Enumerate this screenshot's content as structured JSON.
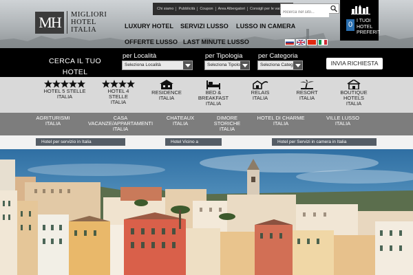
{
  "logo": {
    "mark": "MH",
    "line1": "MIGLIORI",
    "line2": "HOTEL",
    "line3": "ITALIA"
  },
  "toplinks": [
    "Chi siamo",
    "Pubblicità",
    "Coupon",
    "Area Albergatori",
    "Consigli per le vacanze"
  ],
  "search": {
    "placeholder": "Ricerca nel sito..."
  },
  "favorites": {
    "count": "0",
    "label_line1": "I TUOI",
    "label_line2": "HOTEL",
    "label_line3": "PREFERITI"
  },
  "mainnav": {
    "luxury": "LUXURY HOTEL",
    "servizi": "SERVIZI LUSSO",
    "camera": "LUSSO IN CAMERA",
    "offerte": "OFFERTE LUSSO",
    "lastminute": "LAST MINUTE LUSSO"
  },
  "flags": [
    "it-ru",
    "en",
    "de",
    "it"
  ],
  "searchbar": {
    "cerca_line1": "CERCA IL TUO",
    "cerca_line2": "HOTEL",
    "localita_label": "per Località",
    "localita_value": "Seleziona Località",
    "tipologia_label": "per Tipologia",
    "tipologia_value": "Seleziona Tipologia",
    "categoria_label": "per Categoria",
    "categoria_value": "Seleziona Categoria",
    "submit": "INVIA RICHIESTA"
  },
  "categories": [
    {
      "line1": "HOTEL 5 STELLE",
      "line2": "ITALIA",
      "line3": "",
      "icon": "five-stars-icon"
    },
    {
      "line1": "HOTEL 4",
      "line2": "STELLE",
      "line3": "ITALIA",
      "icon": "four-stars-icon"
    },
    {
      "line1": "RESIDENCE",
      "line2": "ITALIA",
      "line3": "",
      "icon": "residence-icon"
    },
    {
      "line1": "BED &",
      "line2": "BREAKFAST",
      "line3": "ITALIA",
      "icon": "bed-icon"
    },
    {
      "line1": "RELAIS",
      "line2": "ITALIA",
      "line3": "",
      "icon": "relais-icon"
    },
    {
      "line1": "RESORT",
      "line2": "ITALIA",
      "line3": "",
      "icon": "palm-tree-icon"
    },
    {
      "line1": "BOUTIQUE",
      "line2": "HOTELS",
      "line3": "ITALIA",
      "icon": "boutique-icon"
    }
  ],
  "subcategories": [
    {
      "line1": "AGRITURISMI",
      "line2": "ITALIA",
      "line3": ""
    },
    {
      "line1": "CASA",
      "line2": "VACANZE/APPARTAMENTI",
      "line3": "ITALIA"
    },
    {
      "line1": "CHATEAUX",
      "line2": "ITALIA",
      "line3": ""
    },
    {
      "line1": "DIMORE",
      "line2": "STORICHE",
      "line3": "ITALIA"
    },
    {
      "line1": "HOTEL DI CHARME",
      "line2": "ITALIA",
      "line3": ""
    },
    {
      "line1": "VILLE LUSSO",
      "line2": "ITALIA",
      "line3": ""
    }
  ],
  "tabs": [
    "Hotel per servizio in Italia",
    "Hotel Vicino a",
    "Hotel per Servizi in camera in Italia"
  ],
  "colors": {
    "accent_blue": "#2a6fb0",
    "nav_dark": "#000000",
    "cats_bg": "#d9d9d9",
    "subcats_bg": "#7d7d7d",
    "tab_bg": "#555d66"
  }
}
